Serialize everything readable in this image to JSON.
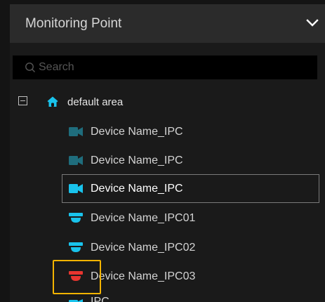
{
  "header": {
    "title": "Monitoring Point",
    "toggle_icon": "chevron-down-icon"
  },
  "search": {
    "placeholder": "Search",
    "icon": "search-icon"
  },
  "tree": {
    "area": {
      "label": "default area",
      "icon": "home-icon",
      "expanded": true
    },
    "devices": [
      {
        "label": "Device Name_IPC",
        "icon": "bullet-camera-icon",
        "state": "offline",
        "color": "#1f6d7d"
      },
      {
        "label": "Device Name_IPC",
        "icon": "bullet-camera-icon",
        "state": "offline",
        "color": "#1f6d7d"
      },
      {
        "label": "Device Name_IPC",
        "icon": "bullet-camera-icon",
        "state": "online",
        "color": "#19c3ec",
        "selected": true
      },
      {
        "label": "Device Name_IPC01",
        "icon": "dome-camera-icon",
        "state": "online",
        "color": "#19c3ec"
      },
      {
        "label": "Device Name_IPC02",
        "icon": "dome-camera-icon",
        "state": "online",
        "color": "#19c3ec"
      },
      {
        "label": "Device Name_IPC03",
        "icon": "dome-camera-icon",
        "state": "alarm",
        "color": "#e8352f"
      }
    ],
    "partial_item": {
      "label": "IPC",
      "icon": "bullet-camera-icon",
      "color": "#19c3ec"
    }
  },
  "colors": {
    "header_bg": "#2b2b2b",
    "panel_bg": "#1a1a1a",
    "search_bg": "#000000",
    "accent_cyan": "#19c3ec",
    "offline_teal": "#1f6d7d",
    "alarm_red": "#e8352f",
    "highlight_yellow": "#f4b400"
  }
}
